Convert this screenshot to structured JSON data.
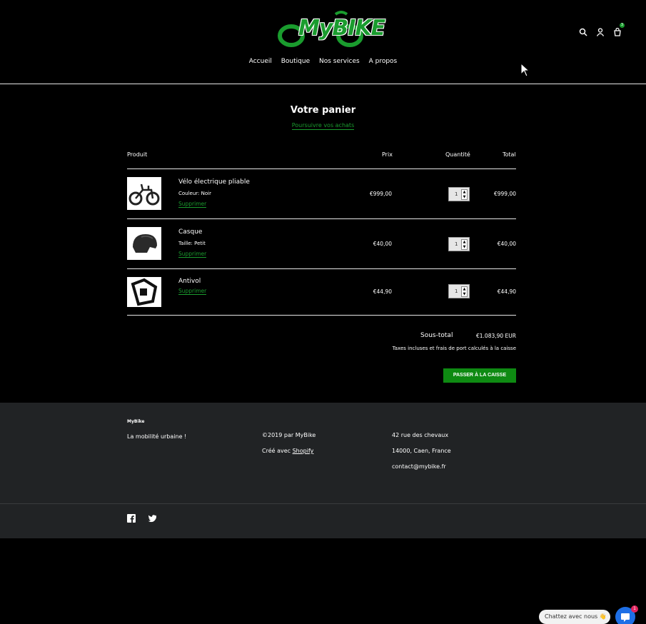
{
  "header": {
    "logo_text": "MyBIKE",
    "nav": [
      "Accueil",
      "Boutique",
      "Nos services",
      "A propos"
    ],
    "cart_count": "3"
  },
  "cart": {
    "title": "Votre panier",
    "continue": "Poursuivre vos achats",
    "columns": {
      "product": "Produit",
      "price": "Prix",
      "quantity": "Quantité",
      "total": "Total"
    },
    "items": [
      {
        "name": "Vélo électrique pliable",
        "variant": "Couleur: Noir",
        "remove": "Supprimer",
        "price": "€999,00",
        "qty": "1",
        "total": "€999,00",
        "image": "folding-ebike"
      },
      {
        "name": "Casque",
        "variant": "Taille: Petit",
        "remove": "Supprimer",
        "price": "€40,00",
        "qty": "1",
        "total": "€40,00",
        "image": "helmet"
      },
      {
        "name": "Antivol",
        "variant": "",
        "remove": "Supprimer",
        "price": "€44,90",
        "qty": "1",
        "total": "€44,90",
        "image": "bike-lock"
      }
    ],
    "subtotal_label": "Sous-total",
    "subtotal_value": "€1.083,90 EUR",
    "tax_note": "Taxes incluses et frais de port calculés à la caisse",
    "checkout": "PASSER À LA CAISSE"
  },
  "footer": {
    "brand": "MyBike",
    "tagline": "La mobilité urbaine !",
    "copyright": "©2019 par MyBike",
    "created_prefix": "Créé avec",
    "created_link": "Shopify",
    "address1": "42 rue des chevaux",
    "address2": "14000, Caen, France",
    "email": "contact@mybike.fr"
  },
  "chat": {
    "label": "Chattez avec nous 👋",
    "badge": "1"
  },
  "colors": {
    "accent": "#1a9c2e",
    "button": "#0e8a12",
    "footer_bg": "#212325"
  }
}
